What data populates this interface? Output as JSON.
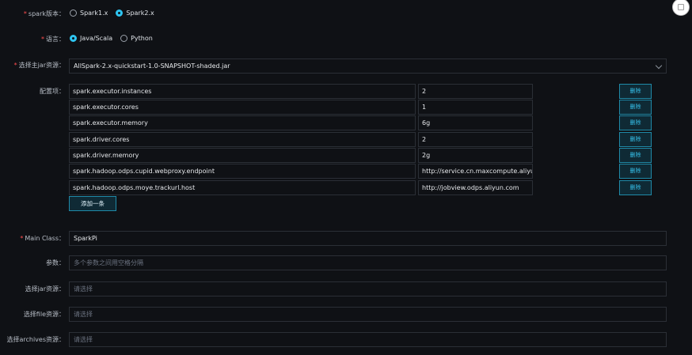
{
  "spark_version": {
    "label": "spark版本：",
    "options": [
      {
        "label": "Spark1.x",
        "checked": false
      },
      {
        "label": "Spark2.x",
        "checked": true
      }
    ]
  },
  "language": {
    "label": "语言：",
    "options": [
      {
        "label": "Java/Scala",
        "checked": true
      },
      {
        "label": "Python",
        "checked": false
      }
    ]
  },
  "main_jar": {
    "label": "选择主jar资源：",
    "value": "AllSpark-2.x-quickstart-1.0-SNAPSHOT-shaded.jar"
  },
  "config": {
    "label": "配置项：",
    "delete_label": "删除",
    "add_label": "添加一条",
    "rows": [
      {
        "key": "spark.executor.instances",
        "value": "2"
      },
      {
        "key": "spark.executor.cores",
        "value": "1"
      },
      {
        "key": "spark.executor.memory",
        "value": "6g"
      },
      {
        "key": "spark.driver.cores",
        "value": "2"
      },
      {
        "key": "spark.driver.memory",
        "value": "2g"
      },
      {
        "key": "spark.hadoop.odps.cupid.webproxy.endpoint",
        "value": "http://service.cn.maxcompute.aliyun"
      },
      {
        "key": "spark.hadoop.odps.moye.trackurl.host",
        "value": "http://jobview.odps.aliyun.com"
      }
    ]
  },
  "main_class": {
    "label": "Main Class：",
    "value": "SparkPi"
  },
  "params": {
    "label": "参数：",
    "placeholder": "多个参数之间用空格分隔"
  },
  "jar_resource": {
    "label": "选择jar资源：",
    "placeholder": "请选择"
  },
  "file_resource": {
    "label": "选择file资源：",
    "placeholder": "请选择"
  },
  "archives_resource": {
    "label": "选择archives资源：",
    "placeholder": "请选择"
  }
}
